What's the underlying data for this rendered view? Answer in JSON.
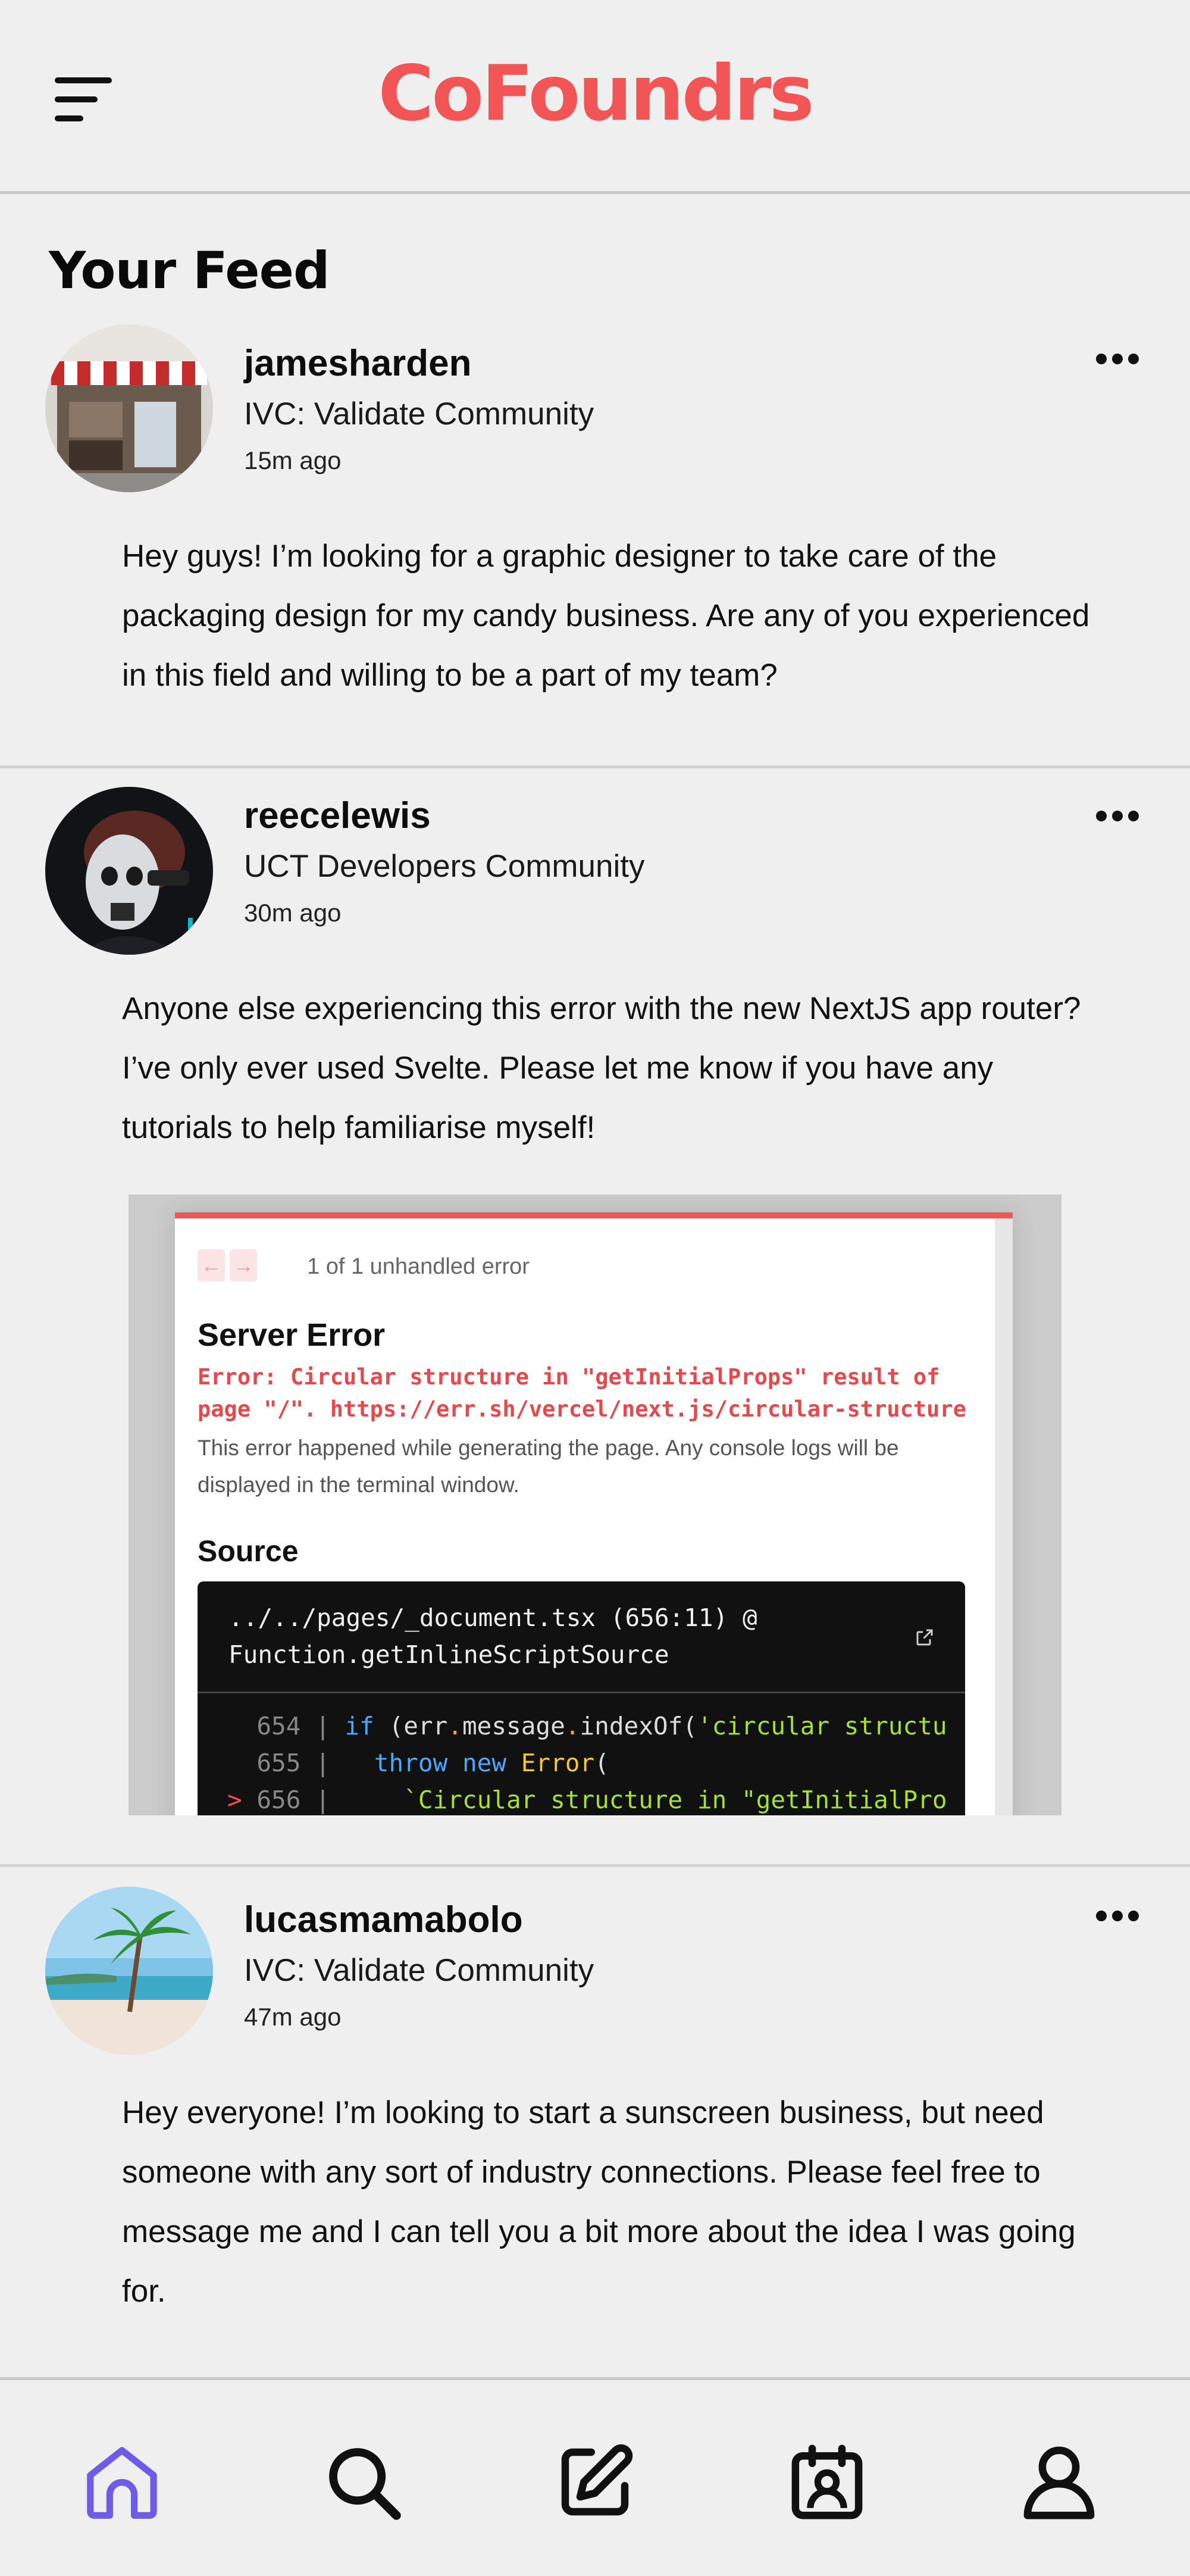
{
  "header": {
    "brand": "CoFoundrs",
    "menu_icon": "hamburger-menu-icon"
  },
  "feed": {
    "title": "Your Feed"
  },
  "posts": [
    {
      "username": "jamesharden",
      "community": "IVC: Validate Community",
      "time": "15m ago",
      "body": "Hey guys! I’m looking for a graphic designer to take care of the packaging design for my candy business. Are any of you experienced in this field and willing to be a part of my team?",
      "more_icon": "more-horizontal-icon"
    },
    {
      "username": "reecelewis",
      "community": "UCT Developers Community",
      "time": "30m ago",
      "body": "Anyone else experiencing this error with the new NextJS app router? I’ve only ever used Svelte. Please let me know if you have any tutorials to help familiarise myself!",
      "more_icon": "more-horizontal-icon",
      "attachment": {
        "nav_prev": "←",
        "nav_next": "→",
        "error_count": "1 of 1 unhandled error",
        "title": "Server Error",
        "message": "Error: Circular structure in \"getInitialProps\" result of page \"/\". https://err.sh/vercel/next.js/circular-structure",
        "description": "This error happened while generating the page. Any console logs will be displayed in the terminal window.",
        "source_label": "Source",
        "source_file": "../../pages/_document.tsx (656:11) @ Function.getInlineScriptSource",
        "code": {
          "line1_no": "654",
          "line1_a": "if (err",
          "line1_b": ".",
          "line1_c": "message",
          "line1_d": ".",
          "line1_e": "indexOf(",
          "line1_f": "'circular structu",
          "line2_no": "655",
          "line2_kw1": "throw",
          "line2_kw2": "new",
          "line2_cls": "Error",
          "line2_rest": "(",
          "line3_marker": ">",
          "line3_no": "656",
          "line3_str": "`Circular structure in \"getInitialPro"
        }
      }
    },
    {
      "username": "lucasmamabolo",
      "community": "IVC: Validate Community",
      "time": "47m ago",
      "body": "Hey everyone! I’m looking to start a sunscreen business, but need someone with any sort of industry connections. Please feel free to message me and I can tell you a bit more about the idea I was going for.",
      "more_icon": "more-horizontal-icon"
    }
  ],
  "bottom_nav": [
    {
      "icon": "home-icon",
      "active": true
    },
    {
      "icon": "search-icon",
      "active": false
    },
    {
      "icon": "edit-post-icon",
      "active": false
    },
    {
      "icon": "calendar-profile-icon",
      "active": false
    },
    {
      "icon": "profile-icon",
      "active": false
    }
  ],
  "colors": {
    "brand": "#f15555",
    "active_nav": "#6c5ce7",
    "background": "#efefef",
    "text": "#111111"
  }
}
